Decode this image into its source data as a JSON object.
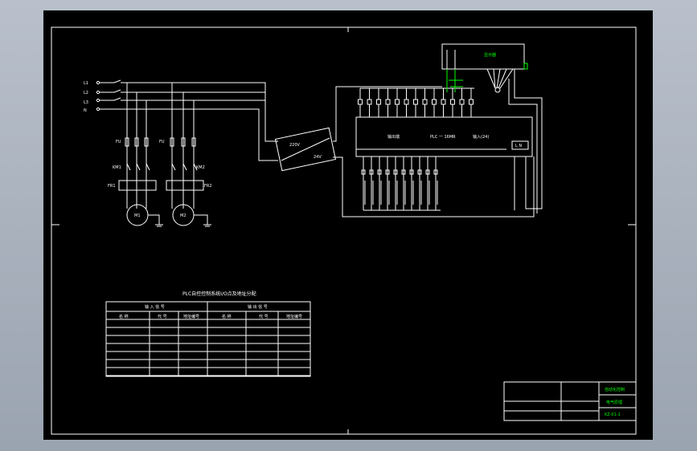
{
  "drawing": {
    "line_labels": [
      "L1",
      "L2",
      "L3",
      "N"
    ],
    "motor1_label": "M1",
    "motor2_label": "M2",
    "fuse1_label": "FU",
    "fuse2_label": "FU",
    "km1_label": "KM1",
    "km2_label": "KM2",
    "fr1_label": "FR1",
    "fr2_label": "FR2",
    "psu_in": "220V",
    "psu_out": "24V",
    "plc_left_text": "输出端",
    "plc_mid_text": "PLC 一 16MR",
    "plc_right_text": "输入(24)",
    "display_label": "显示器",
    "table_title": "PLC自控控制系统I/O点及地址分配",
    "input_header": "输 入 信 号",
    "output_header": "输 出 信 号",
    "col_headers": [
      "名 称",
      "代 号",
      "地址编号",
      "名 称",
      "代 号",
      "地址编号"
    ],
    "title_block_name": "自动化控制",
    "title_block_sub": "电气原理",
    "title_block_code": "KZ-01-1"
  },
  "colors": {
    "background": "#000000",
    "line": "#ffffff",
    "highlight": "#00ff00"
  }
}
